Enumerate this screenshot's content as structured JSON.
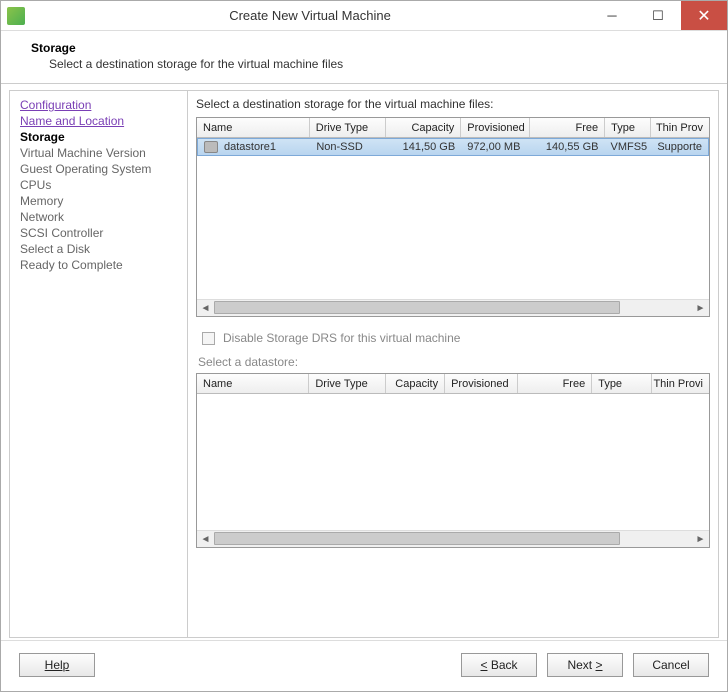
{
  "window": {
    "title": "Create New Virtual Machine"
  },
  "header": {
    "title": "Storage",
    "subtitle": "Select a destination storage for the virtual machine files"
  },
  "sidebar": {
    "steps": [
      {
        "label": "Configuration",
        "state": "link"
      },
      {
        "label": "Name and Location",
        "state": "link"
      },
      {
        "label": "Storage",
        "state": "current"
      },
      {
        "label": "Virtual Machine Version",
        "state": "future"
      },
      {
        "label": "Guest Operating System",
        "state": "future"
      },
      {
        "label": "CPUs",
        "state": "future"
      },
      {
        "label": "Memory",
        "state": "future"
      },
      {
        "label": "Network",
        "state": "future"
      },
      {
        "label": "SCSI Controller",
        "state": "future"
      },
      {
        "label": "Select a Disk",
        "state": "future"
      },
      {
        "label": "Ready to Complete",
        "state": "future"
      }
    ]
  },
  "main": {
    "prompt": "Select a destination storage for the virtual machine files:",
    "topGrid": {
      "columns": {
        "name": "Name",
        "drive": "Drive Type",
        "capacity": "Capacity",
        "provisioned": "Provisioned",
        "free": "Free",
        "type": "Type",
        "thin": "Thin Prov"
      },
      "rows": [
        {
          "name": "datastore1",
          "drive": "Non-SSD",
          "capacity": "141,50 GB",
          "provisioned": "972,00 MB",
          "free": "140,55 GB",
          "type": "VMFS5",
          "thin": "Supporte"
        }
      ]
    },
    "drsCheckbox": {
      "label": "Disable Storage DRS for this virtual machine",
      "checked": false,
      "enabled": false
    },
    "subPrompt": "Select a datastore:",
    "bottomGrid": {
      "columns": {
        "name": "Name",
        "drive": "Drive Type",
        "capacity": "Capacity",
        "provisioned": "Provisioned",
        "free": "Free",
        "type": "Type",
        "thin": "Thin Provi"
      }
    }
  },
  "buttons": {
    "help": "Help",
    "back": "Back",
    "next": "Next",
    "cancel": "Cancel"
  }
}
